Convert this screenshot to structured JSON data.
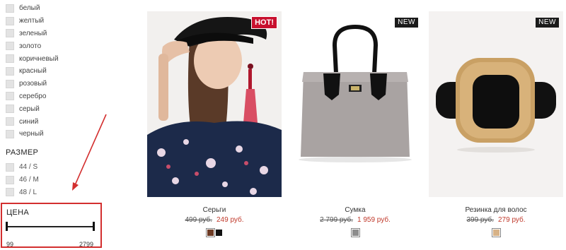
{
  "filters": {
    "colors": [
      {
        "label": "белый"
      },
      {
        "label": "желтый"
      },
      {
        "label": "зеленый"
      },
      {
        "label": "золото"
      },
      {
        "label": "коричневый"
      },
      {
        "label": "красный"
      },
      {
        "label": "розовый"
      },
      {
        "label": "серебро"
      },
      {
        "label": "серый"
      },
      {
        "label": "синий"
      },
      {
        "label": "черный"
      }
    ],
    "size_heading": "РАЗМЕР",
    "sizes": [
      {
        "label": "44 / S"
      },
      {
        "label": "46 / M"
      },
      {
        "label": "48 / L"
      }
    ],
    "price_heading": "ЦЕНА",
    "price_min": "99",
    "price_max": "2799"
  },
  "products": [
    {
      "name": "Серьги",
      "old_price": "499 руб.",
      "new_price": "249 руб.",
      "badge": "HOT!",
      "swatches": [
        "#6d3b24",
        "#111111"
      ]
    },
    {
      "name": "Сумка",
      "old_price": "2 799 руб.",
      "new_price": "1 959 руб.",
      "badge": "NEW",
      "swatches": [
        "#8d8d8d"
      ]
    },
    {
      "name": "Резинка для волос",
      "old_price": "399 руб.",
      "new_price": "279 руб.",
      "badge": "NEW",
      "swatches": [
        "#d7b287"
      ]
    }
  ],
  "colors": {
    "accent_red": "#d32f2f",
    "sale_price": "#c0392b",
    "hot_badge": "#c8102e",
    "new_badge": "#1b1b1b"
  }
}
